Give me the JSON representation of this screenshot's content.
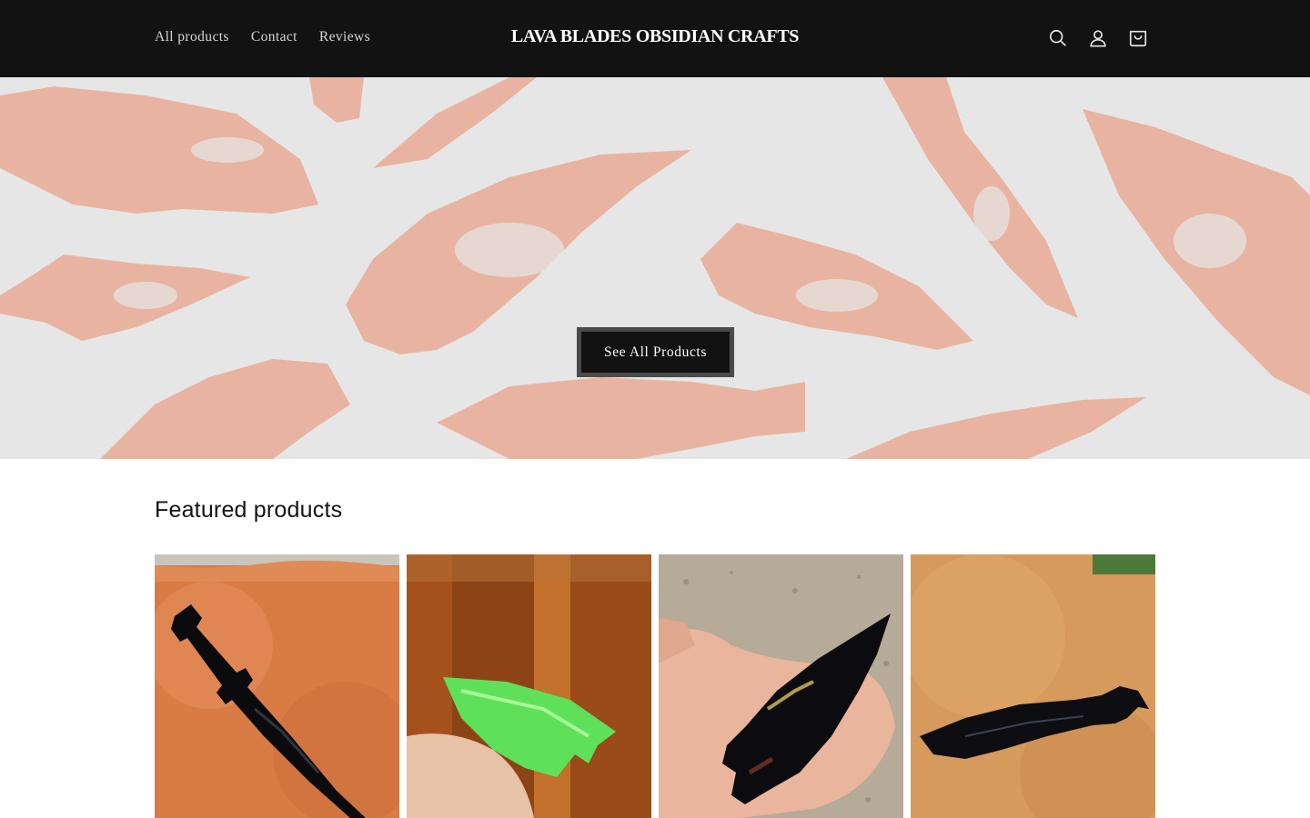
{
  "header": {
    "nav": [
      "All products",
      "Contact",
      "Reviews"
    ],
    "logo": "LAVA BLADES OBSIDIAN CRAFTS",
    "icons": [
      "search-icon",
      "account-icon",
      "cart-icon"
    ]
  },
  "hero": {
    "button_label": "See All Products",
    "colors": {
      "background": "#e6e6e6",
      "pattern": "#e8b4a1"
    }
  },
  "featured": {
    "title": "Featured products",
    "products": [
      {
        "image": "black obsidian dagger on leather"
      },
      {
        "image": "green glass arrowhead in hand"
      },
      {
        "image": "black obsidian spearhead in hand"
      },
      {
        "image": "black obsidian knife on leather"
      }
    ]
  },
  "colors": {
    "header_bg": "#121212",
    "button_bg": "#121212",
    "button_border": "#4a4a4a"
  }
}
